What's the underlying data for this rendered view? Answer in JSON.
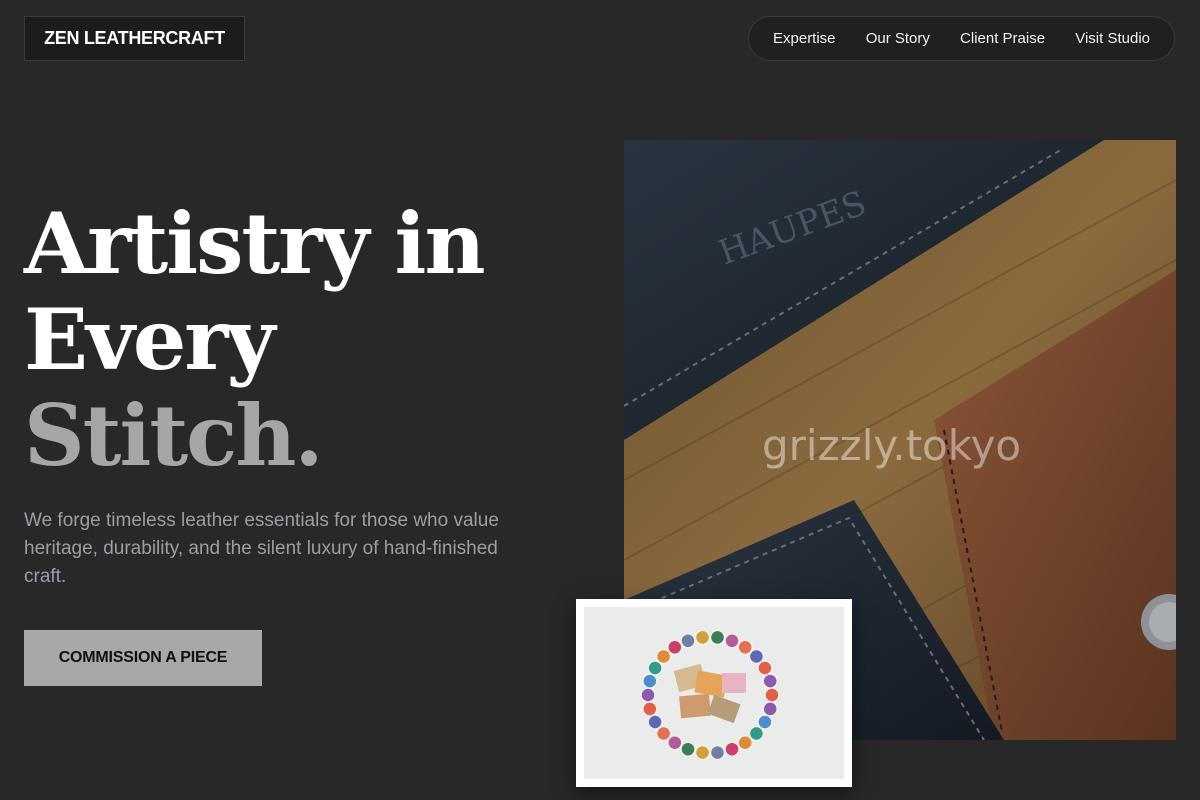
{
  "brand": {
    "name": "ZEN LEATHERCRAFT"
  },
  "nav": {
    "items": [
      {
        "label": "Expertise"
      },
      {
        "label": "Our Story"
      },
      {
        "label": "Client Praise"
      },
      {
        "label": "Visit Studio"
      }
    ]
  },
  "hero": {
    "title_lines": [
      "Artistry in",
      "Every",
      "Stitch."
    ],
    "description": "We forge timeless leather essentials for those who value heritage, durability, and the silent luxury of hand-finished craft.",
    "cta_label": "COMMISSION A PIECE"
  },
  "images": {
    "main": {
      "subject": "leather wallets on wood",
      "embossed_text": "HAUPES",
      "watermark": "grizzly.tokyo"
    },
    "thumb": {
      "subject": "ring of colored thread spools"
    }
  },
  "colors": {
    "background": "#282828",
    "accent_button": "#a8a8a8",
    "muted_text": "#a6a6a6"
  }
}
